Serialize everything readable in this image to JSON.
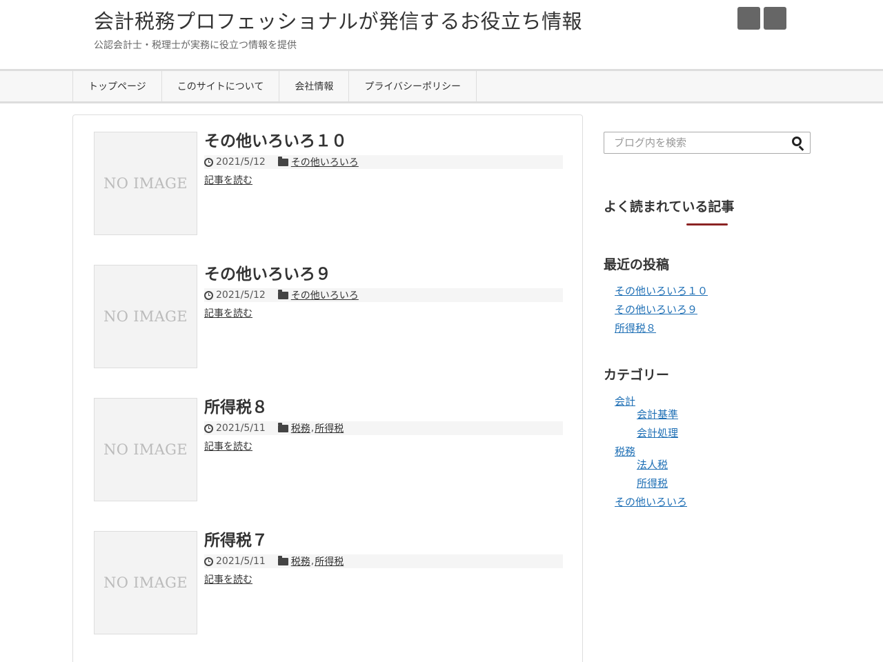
{
  "header": {
    "title": "会計税務プロフェッショナルが発信するお役立ち情報",
    "description": "公認会計士・税理士が実務に役立つ情報を提供"
  },
  "nav": {
    "items": [
      "トップページ",
      "このサイトについて",
      "会社情報",
      "プライバシーポリシー"
    ]
  },
  "entries": [
    {
      "title": "その他いろいろ１０",
      "date": "2021/5/12",
      "categories": [
        "その他いろいろ"
      ],
      "read_more": "記事を読む",
      "thumb_text": "NO IMAGE"
    },
    {
      "title": "その他いろいろ９",
      "date": "2021/5/12",
      "categories": [
        "その他いろいろ"
      ],
      "read_more": "記事を読む",
      "thumb_text": "NO IMAGE"
    },
    {
      "title": "所得税８",
      "date": "2021/5/11",
      "categories": [
        "税務",
        "所得税"
      ],
      "read_more": "記事を読む",
      "thumb_text": "NO IMAGE"
    },
    {
      "title": "所得税７",
      "date": "2021/5/11",
      "categories": [
        "税務",
        "所得税"
      ],
      "read_more": "記事を読む",
      "thumb_text": "NO IMAGE"
    }
  ],
  "category_separator": ",",
  "sidebar": {
    "search_placeholder": "ブログ内を検索",
    "popular_title": "よく読まれている記事",
    "recent_title": "最近の投稿",
    "recent_posts": [
      "その他いろいろ１０",
      "その他いろいろ９",
      "所得税８"
    ],
    "categories_title": "カテゴリー",
    "categories": {
      "accounting": "会計",
      "accounting_standards": "会計基準",
      "accounting_processing": "会計処理",
      "tax": "税務",
      "corporate_tax": "法人税",
      "income_tax": "所得税",
      "misc": "その他いろいろ"
    }
  },
  "colors": {
    "link": "#1e6fb5",
    "accent_underline": "#8b2323",
    "header_button": "#666666"
  }
}
